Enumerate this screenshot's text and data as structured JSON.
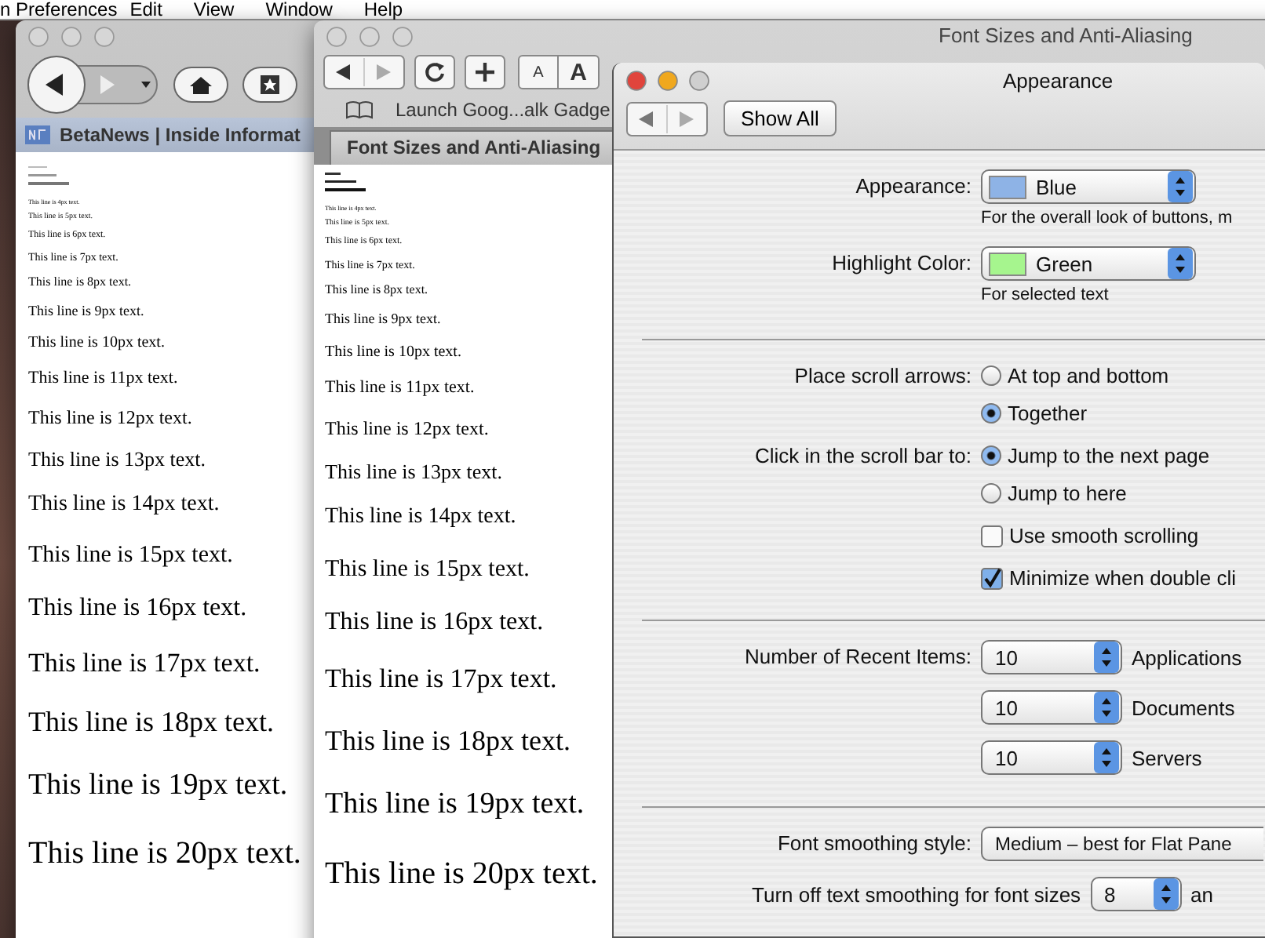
{
  "menubar": {
    "items": [
      "n Preferences",
      "Edit",
      "View",
      "Window",
      "Help"
    ]
  },
  "browser_left": {
    "active": false,
    "bookmarks": [
      "BetaNews | Inside Informat"
    ],
    "lines": [
      "This line is 4px text.",
      "This line is 5px text.",
      "This line is 6px text.",
      "This line is 7px text.",
      "This line is 8px text.",
      "This line is 9px text.",
      "This line is 10px text.",
      "This line is 11px text.",
      "This line is 12px text.",
      "This line is 13px text.",
      "This line is 14px text.",
      "This line is 15px text.",
      "This line is 16px text.",
      "This line is 17px text.",
      "This line is 18px text.",
      "This line is 19px text.",
      "This line is 20px text."
    ]
  },
  "browser_middle": {
    "active": false,
    "title": "Font Sizes and Anti-Aliasing",
    "font_buttons": [
      "A",
      "A"
    ],
    "bookmarks": [
      "Launch Goog...alk Gadge"
    ],
    "tab": "Font Sizes and Anti-Aliasing",
    "lines": [
      "This line is 4px text.",
      "This line is 5px text.",
      "This line is 6px text.",
      "This line is 7px text.",
      "This line is 8px text.",
      "This line is 9px text.",
      "This line is 10px text.",
      "This line is 11px text.",
      "This line is 12px text.",
      "This line is 13px text.",
      "This line is 14px text.",
      "This line is 15px text.",
      "This line is 16px text.",
      "This line is 17px text.",
      "This line is 18px text.",
      "This line is 19px text.",
      "This line is 20px text."
    ]
  },
  "appearance_window": {
    "active": true,
    "title": "Appearance",
    "show_all": "Show All",
    "sections": [
      {
        "rows": [
          {
            "kind": "popup",
            "label": "Appearance:",
            "value": "Blue",
            "color": "#8eb3e6",
            "hint": "For the overall look of buttons, m"
          },
          {
            "kind": "popup",
            "label": "Highlight Color:",
            "value": "Green",
            "color": "#a6f58e",
            "hint": "For selected text"
          }
        ]
      },
      {
        "rows": [
          {
            "kind": "radios",
            "label": "Place scroll arrows:",
            "options": [
              {
                "label": "At top and bottom",
                "selected": false
              },
              {
                "label": "Together",
                "selected": true
              }
            ]
          },
          {
            "kind": "radios",
            "label": "Click in the scroll bar to:",
            "options": [
              {
                "label": "Jump to the next page",
                "selected": true
              },
              {
                "label": "Jump to here",
                "selected": false
              }
            ]
          },
          {
            "kind": "checkbox",
            "label": "Use smooth scrolling",
            "checked": false
          },
          {
            "kind": "checkbox",
            "label": "Minimize when double cli",
            "checked": true
          }
        ]
      },
      {
        "rows": [
          {
            "kind": "recent",
            "label": "Number of Recent Items:",
            "value": "10",
            "caption": "Applications"
          },
          {
            "kind": "recent",
            "value": "10",
            "caption": "Documents"
          },
          {
            "kind": "recent",
            "value": "10",
            "caption": "Servers"
          }
        ]
      },
      {
        "rows": [
          {
            "kind": "wide_popup",
            "label": "Font smoothing style:",
            "value": "Medium – best for Flat Pane"
          },
          {
            "kind": "inline_popup",
            "label": "Turn off text smoothing for font sizes",
            "value": "8",
            "suffix": "an"
          }
        ]
      }
    ]
  }
}
